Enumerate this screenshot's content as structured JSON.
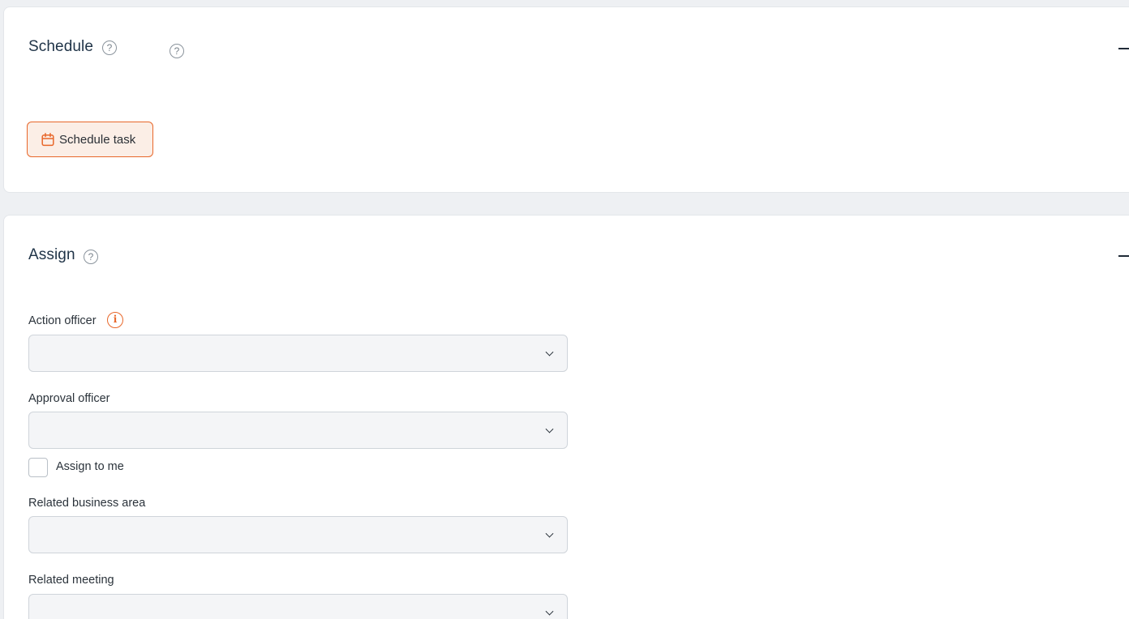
{
  "schedule_section": {
    "title": "Schedule",
    "help_glyph": "?",
    "collapse_icon": "minus-icon",
    "schedule_task_button": {
      "label": "Schedule task",
      "icon": "calendar-icon"
    }
  },
  "assign_section": {
    "title": "Assign",
    "help_glyph": "?",
    "collapse_icon": "minus-icon",
    "action_officer": {
      "label": "Action officer",
      "value": "",
      "info_glyph": "i"
    },
    "approval_officer": {
      "label": "Approval officer",
      "value": ""
    },
    "assign_to_me": {
      "label": "Assign to me",
      "checked": false
    },
    "related_business_area": {
      "label": "Related business area",
      "value": ""
    },
    "related_meeting": {
      "label": "Related meeting",
      "value": ""
    }
  },
  "colors": {
    "accent": "#e8672a",
    "accent_bg": "#fbeee6",
    "page_bg": "#eef0f3",
    "title": "#1f3347"
  }
}
